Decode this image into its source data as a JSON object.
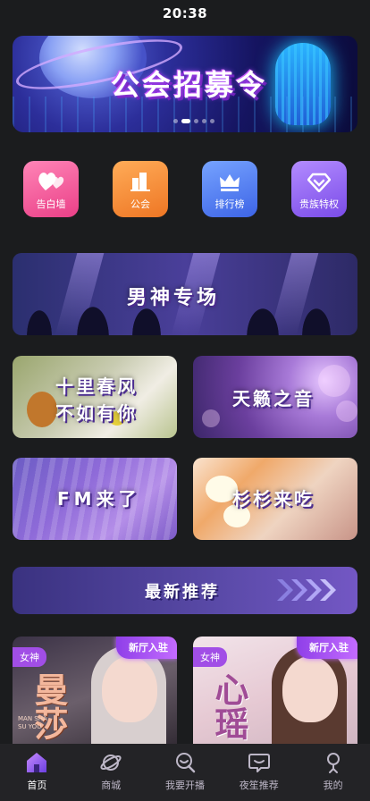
{
  "status_bar": {
    "time": "20:38"
  },
  "banner": {
    "title": "公会招募令",
    "dots": 5,
    "active_dot": 1
  },
  "quick_menu": [
    {
      "label": "告白墙",
      "icon": "hearts-icon"
    },
    {
      "label": "公会",
      "icon": "building-icon"
    },
    {
      "label": "排行榜",
      "icon": "crown-icon"
    },
    {
      "label": "贵族特权",
      "icon": "diamond-icon"
    }
  ],
  "sections": {
    "male_hall": "男神专场",
    "spring_line1": "十里春风",
    "spring_line2": "不如有你",
    "heavenly_voice": "天籁之音",
    "fm": "FM来了",
    "eat": "杉杉来吃"
  },
  "recommend": {
    "title": "最新推荐"
  },
  "rooms": [
    {
      "tag": "女神",
      "badge": "新厅入驻",
      "name": "曼莎",
      "sub": "MAN SHA\nSU YOU"
    },
    {
      "tag": "女神",
      "badge": "新厅入驻",
      "name": "心瑶",
      "sub": ""
    }
  ],
  "tab_bar": [
    {
      "label": "首页",
      "icon": "home-icon",
      "active": true
    },
    {
      "label": "商城",
      "icon": "planet-icon",
      "active": false
    },
    {
      "label": "我要开播",
      "icon": "broadcast-icon",
      "active": false
    },
    {
      "label": "夜笙推荐",
      "icon": "chat-icon",
      "active": false
    },
    {
      "label": "我的",
      "icon": "profile-icon",
      "active": false
    }
  ],
  "colors": {
    "background": "#1b1c1e",
    "accent_purple": "#a14ee6",
    "tab_active": "#ffffff",
    "tab_inactive": "#bdb7c7"
  }
}
